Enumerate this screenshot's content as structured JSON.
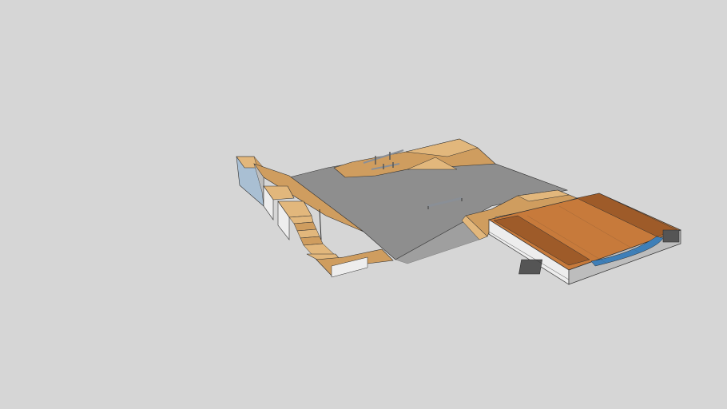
{
  "scene": {
    "background_color": "#d6d6d6",
    "colors": {
      "concrete": "#8e8e8e",
      "concrete_dark": "#7b7b7b",
      "wood_light": "#e2b77c",
      "wood_mid": "#cf9d5f",
      "wood_dark": "#a8774a",
      "deck_orange": "#c77a3b",
      "deck_orange_dark": "#9e5b29",
      "side_white": "#ededed",
      "side_grey": "#bdbdbd",
      "wall_blue": "#a9bfd3",
      "transition_blue": "#3e7fb8",
      "rail_metal": "#8a8f96",
      "edge": "#2f2f2f"
    },
    "objects": [
      {
        "name": "concrete-ground"
      },
      {
        "name": "stair-set"
      },
      {
        "name": "funbox-with-rails"
      },
      {
        "name": "center-flat-rail"
      },
      {
        "name": "mini-ramp"
      },
      {
        "name": "kicker-ramp"
      },
      {
        "name": "quarter-pipe-wall"
      }
    ]
  }
}
